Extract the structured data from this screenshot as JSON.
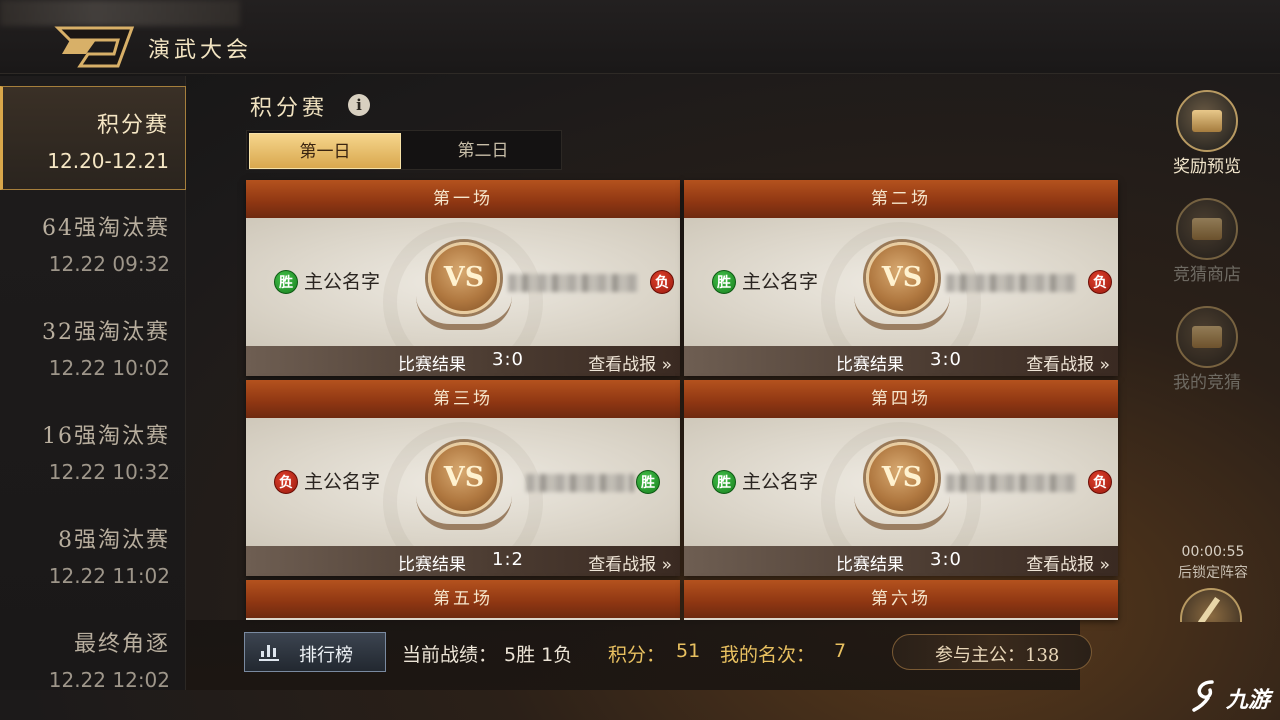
{
  "window": {
    "title": "演武大会"
  },
  "sidebar": {
    "items": [
      {
        "name": "积分赛",
        "time": "12.20-12.21",
        "active": true
      },
      {
        "name": "64强淘汰赛",
        "time": "12.22 09:32",
        "active": false
      },
      {
        "name": "32强淘汰赛",
        "time": "12.22 10:02",
        "active": false
      },
      {
        "name": "16强淘汰赛",
        "time": "12.22 10:32",
        "active": false
      },
      {
        "name": "8强淘汰赛",
        "time": "12.22 11:02",
        "active": false
      },
      {
        "name": "最终角逐",
        "time": "12.22 12:02",
        "active": false
      }
    ]
  },
  "main": {
    "section_title": "积分赛",
    "info_icon": "i",
    "tabs": [
      {
        "label": "第一日",
        "active": true
      },
      {
        "label": "第二日",
        "active": false
      }
    ],
    "matches": [
      {
        "title": "第一场",
        "left_name": "主公名字",
        "left_result": "胜",
        "right_result": "负",
        "vs": "VS",
        "result_label": "比赛结果",
        "score": "3:0",
        "report": "查看战报 »"
      },
      {
        "title": "第二场",
        "left_name": "主公名字",
        "left_result": "胜",
        "right_result": "负",
        "vs": "VS",
        "result_label": "比赛结果",
        "score": "3:0",
        "report": "查看战报 »"
      },
      {
        "title": "第三场",
        "left_name": "主公名字",
        "left_result": "负",
        "right_result": "胜",
        "vs": "VS",
        "result_label": "比赛结果",
        "score": "1:2",
        "report": "查看战报 »"
      },
      {
        "title": "第四场",
        "left_name": "主公名字",
        "left_result": "胜",
        "right_result": "负",
        "vs": "VS",
        "result_label": "比赛结果",
        "score": "3:0",
        "report": "查看战报 »"
      },
      {
        "title": "第五场"
      },
      {
        "title": "第六场"
      }
    ]
  },
  "bottom": {
    "rank_button": "排行榜",
    "record_label": "当前战绩：",
    "record_value": "5胜 1负",
    "points_label": "积分：",
    "points_value": "51",
    "rank_label": "我的名次：",
    "rank_value": "7",
    "participate_text": "参与主公：138"
  },
  "right": {
    "buttons": [
      {
        "label": "奖励预览",
        "icon": "treasure-chest-icon",
        "enabled": true
      },
      {
        "label": "竞猜商店",
        "icon": "shop-icon",
        "enabled": false
      },
      {
        "label": "我的竞猜",
        "icon": "chest-icon",
        "enabled": false
      }
    ],
    "countdown": "00:00:55",
    "countdown_label": "后锁定阵容"
  },
  "watermark": {
    "text": "九游"
  },
  "colors": {
    "accent_gold": "#d9a74a",
    "card_header": "#a4461a",
    "win_green": "#1e9a28",
    "lose_red": "#c0281a",
    "points_yellow": "#e8c060"
  }
}
